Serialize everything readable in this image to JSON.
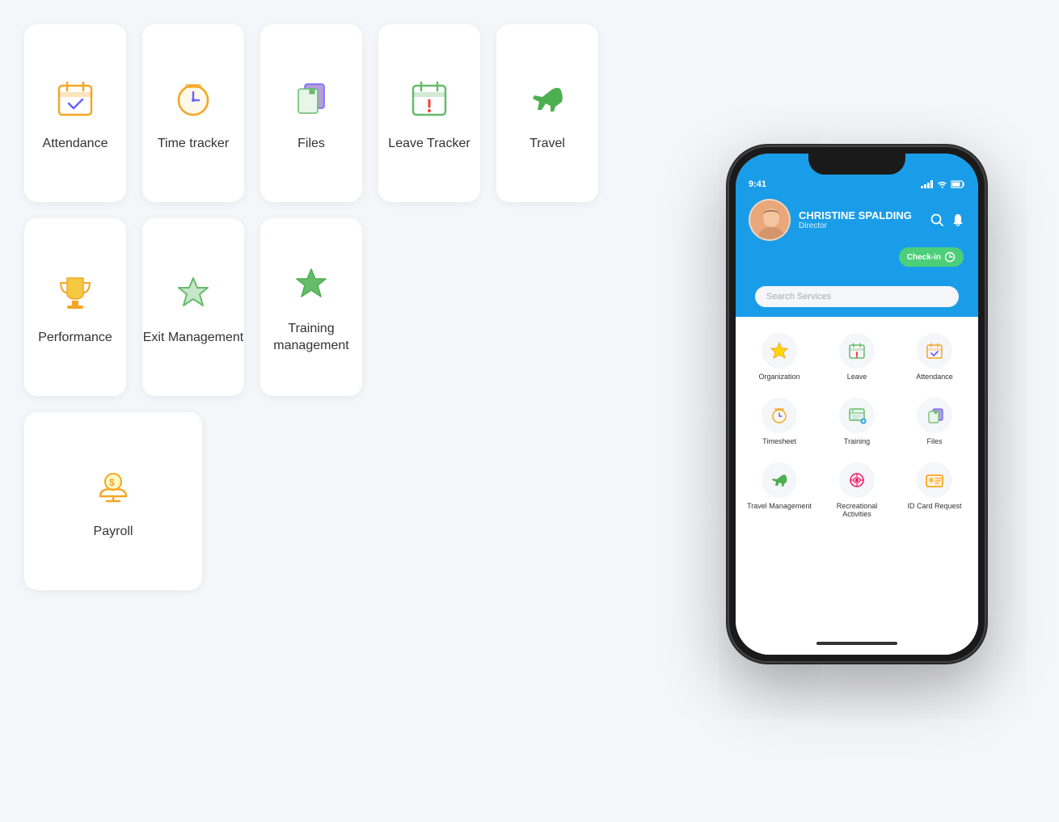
{
  "cards": [
    {
      "id": "attendance",
      "label": "Attendance",
      "icon": "calendar-check",
      "row": 0
    },
    {
      "id": "time-tracker",
      "label": "Time tracker",
      "icon": "clock",
      "row": 0
    },
    {
      "id": "files",
      "label": "Files",
      "icon": "files",
      "row": 0
    },
    {
      "id": "leave-tracker",
      "label": "Leave Tracker",
      "icon": "calendar-exclaim",
      "row": 0
    },
    {
      "id": "travel",
      "label": "Travel",
      "icon": "plane",
      "row": 0
    },
    {
      "id": "performance",
      "label": "Performance",
      "icon": "trophy",
      "row": 1
    },
    {
      "id": "exit-management",
      "label": "Exit Management",
      "icon": "star-outline",
      "row": 1
    },
    {
      "id": "training-management",
      "label": "Training management",
      "icon": "star-filled",
      "row": 1
    },
    {
      "id": "payroll",
      "label": "Payroll",
      "icon": "money-hand",
      "row": 2
    }
  ],
  "phone": {
    "time": "9:41",
    "user_name": "CHRISTINE SPALDING",
    "user_role": "Director",
    "checkin_label": "Check-in",
    "search_placeholder": "Search Services",
    "grid_items": [
      {
        "id": "organization",
        "label": "Organization",
        "icon": "⭐",
        "color": "#fff3cd"
      },
      {
        "id": "leave",
        "label": "Leave",
        "icon": "📅",
        "color": "#fff3cd"
      },
      {
        "id": "attendance",
        "label": "Attendance",
        "icon": "📆",
        "color": "#fff3cd"
      },
      {
        "id": "timesheet",
        "label": "Timesheet",
        "icon": "⏰",
        "color": "#fff3cd"
      },
      {
        "id": "training",
        "label": "Training",
        "icon": "📊",
        "color": "#e8f5e9"
      },
      {
        "id": "files",
        "label": "Files",
        "icon": "📁",
        "color": "#ede7f6"
      },
      {
        "id": "travel-mgmt",
        "label": "Travel Management",
        "icon": "✈️",
        "color": "#fff"
      },
      {
        "id": "recreational",
        "label": "Recreational Activities",
        "icon": "🎯",
        "color": "#fce4ec"
      },
      {
        "id": "id-card",
        "label": "ID Card Request",
        "icon": "🏷️",
        "color": "#fff3e0"
      }
    ]
  }
}
